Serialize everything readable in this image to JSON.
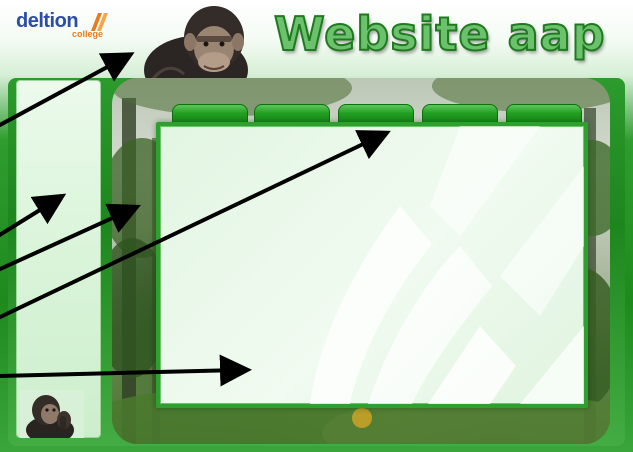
{
  "header": {
    "logo_text": "deltion",
    "logo_sub": "college",
    "site_title": "Website aap"
  },
  "nav": {
    "tabs": [
      "",
      "",
      "",
      "",
      ""
    ]
  },
  "colors": {
    "brand_green": "#22a022",
    "title_fill": "#6cc16c",
    "panel_border": "#2ea02e",
    "logo_blue": "#2b4da8",
    "logo_orange": "#e87b1a",
    "arrow": "#000000"
  },
  "icons": {
    "top_image": "chimpanzee-photo",
    "sidebar_image": "thinking-chimpanzee-photo",
    "background_image": "jungle-photo",
    "annotations": "pointer-arrows"
  }
}
